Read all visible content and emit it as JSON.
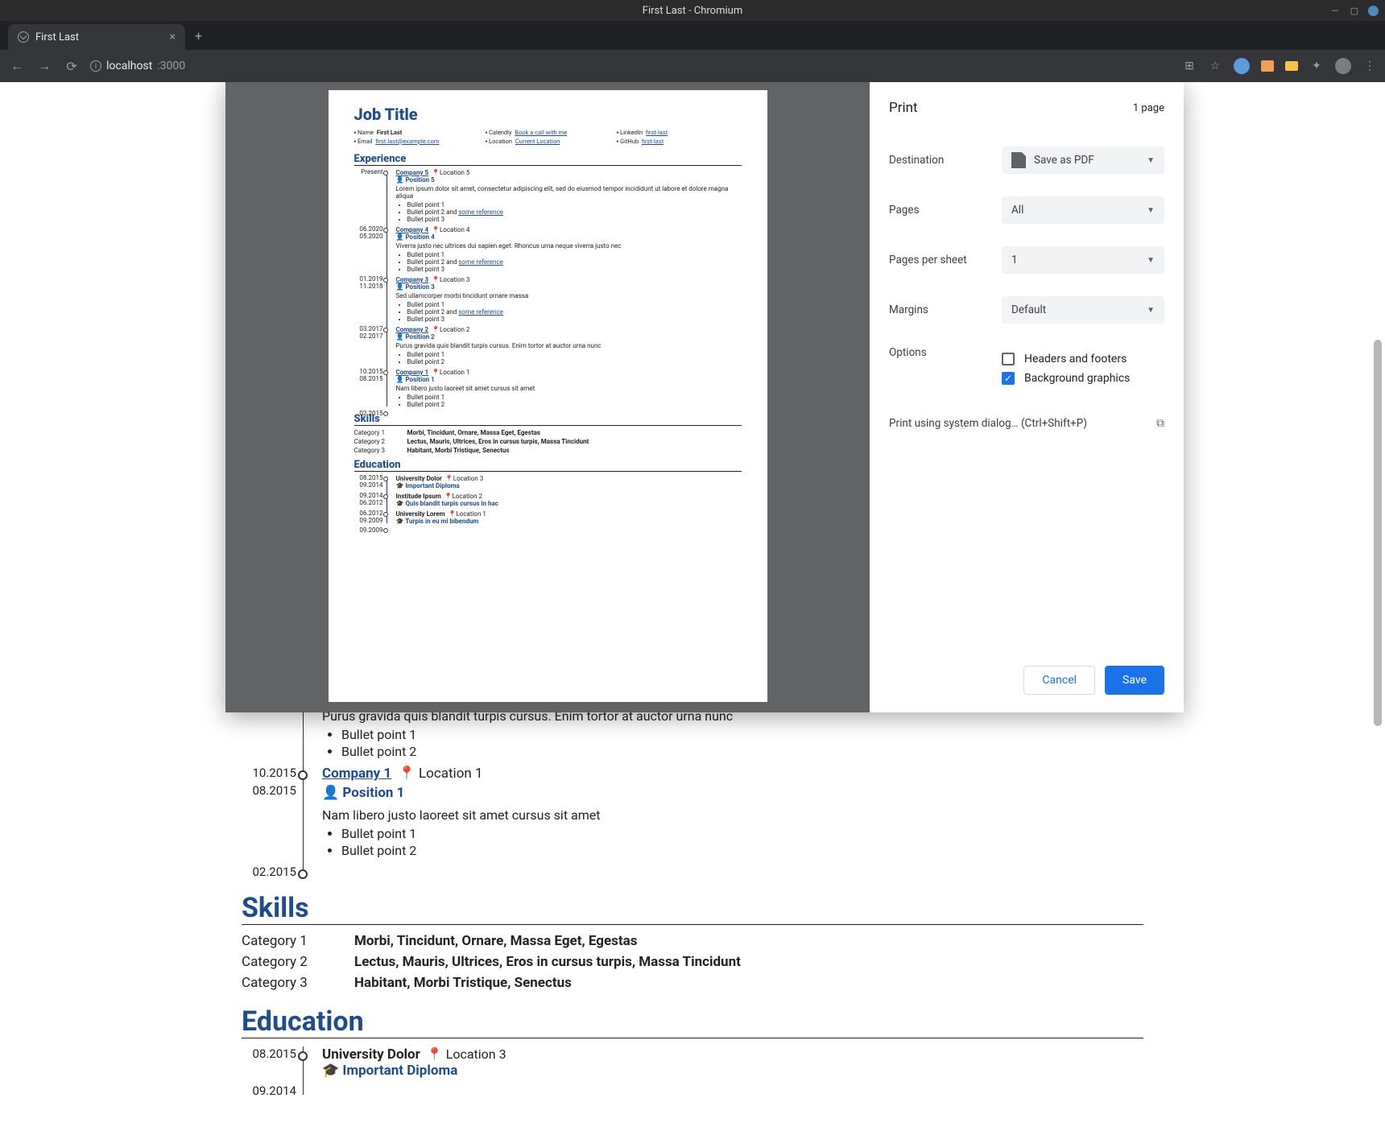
{
  "window": {
    "title": "First Last - Chromium"
  },
  "tab": {
    "title": "First Last"
  },
  "url": {
    "host": "localhost",
    "path": ":3000"
  },
  "print": {
    "title": "Print",
    "page_count": "1 page",
    "labels": {
      "destination": "Destination",
      "pages": "Pages",
      "pages_per_sheet": "Pages per sheet",
      "margins": "Margins",
      "options": "Options"
    },
    "destination": "Save as PDF",
    "pages": "All",
    "pages_per_sheet": "1",
    "margins": "Default",
    "opt_headers": {
      "label": "Headers and footers",
      "checked": false
    },
    "opt_bg": {
      "label": "Background graphics",
      "checked": true
    },
    "system_dialog": "Print using system dialog… (Ctrl+Shift+P)",
    "cancel": "Cancel",
    "save": "Save"
  },
  "resume": {
    "job_title": "Job Title",
    "contact": {
      "name_label": "Name",
      "name": "First Last",
      "calendly_label": "Calendly",
      "calendly": "Book a call with me",
      "linkedin_label": "LinkedIn",
      "linkedin": "first-last",
      "email_label": "Email",
      "email": "first.last@example.com",
      "location_label": "Location",
      "location": "Current Location",
      "github_label": "GitHub",
      "github": "first-last"
    },
    "sections": {
      "experience": "Experience",
      "skills": "Skills",
      "education": "Education"
    },
    "experience": [
      {
        "start": "Present",
        "end": "",
        "company": "Company 5",
        "location": "Location 5",
        "position": "Position 5",
        "desc": "Lorem ipsum dolor sit amet, consectetur adipiscing elit, sed do eiusmod tempor incididunt ut labore et dolore magna aliqua",
        "bullets": [
          "Bullet point 1",
          "Bullet point 2 and ",
          "Bullet point 3"
        ],
        "ref": "some reference"
      },
      {
        "start": "06.2020",
        "end": "05.2020",
        "company": "Company 4",
        "location": "Location 4",
        "position": "Position 4",
        "desc": "Viverra justo nec ultrices dui sapien eget. Rhoncus urna neque viverra justo nec",
        "bullets": [
          "Bullet point 1",
          "Bullet point 2 and ",
          "Bullet point 3"
        ],
        "ref": "some reference"
      },
      {
        "start": "01.2019",
        "end": "11.2018",
        "company": "Company 3",
        "location": "Location 3",
        "position": "Position 3",
        "desc": "Sed ullamcorper morbi tincidunt ornare massa",
        "bullets": [
          "Bullet point 1",
          "Bullet point 2 and ",
          "Bullet point 3"
        ],
        "ref": "some reference"
      },
      {
        "start": "03.2017",
        "end": "02.2017",
        "company": "Company 2",
        "location": "Location 2",
        "position": "Position 2",
        "desc": "Purus gravida quis blandit turpis cursus. Enim tortor at auctor urna nunc",
        "bullets": [
          "Bullet point 1",
          "Bullet point 2"
        ],
        "ref": ""
      },
      {
        "start": "10.2015",
        "end": "08.2015",
        "company": "Company 1",
        "location": "Location 1",
        "position": "Position 1",
        "desc": "Nam libero justo laoreet sit amet cursus sit amet",
        "bullets": [
          "Bullet point 1",
          "Bullet point 2"
        ],
        "ref": ""
      }
    ],
    "exp_end_date": "02.2015",
    "skills": [
      {
        "cat": "Category 1",
        "val": "Morbi, Tincidunt, Ornare, Massa Eget, Egestas"
      },
      {
        "cat": "Category 2",
        "val": "Lectus, Mauris, Ultrices, Eros in cursus turpis, Massa Tincidunt"
      },
      {
        "cat": "Category 3",
        "val": "Habitant, Morbi Tristique, Senectus"
      }
    ],
    "education": [
      {
        "start": "08.2015",
        "end": "09.2014",
        "school": "University Dolor",
        "location": "Location 3",
        "degree": "Important Diploma"
      },
      {
        "start": "09.2014",
        "end": "06.2012",
        "school": "Institude Ipsum",
        "location": "Location 2",
        "degree": "Quis blandit turpis cursus in hac"
      },
      {
        "start": "06.2012",
        "end": "09.2009",
        "school": "University Lorem",
        "location": "Location 1",
        "degree": "Turpis in eu mi bibendum"
      }
    ],
    "edu_end_date": "09.2009"
  }
}
